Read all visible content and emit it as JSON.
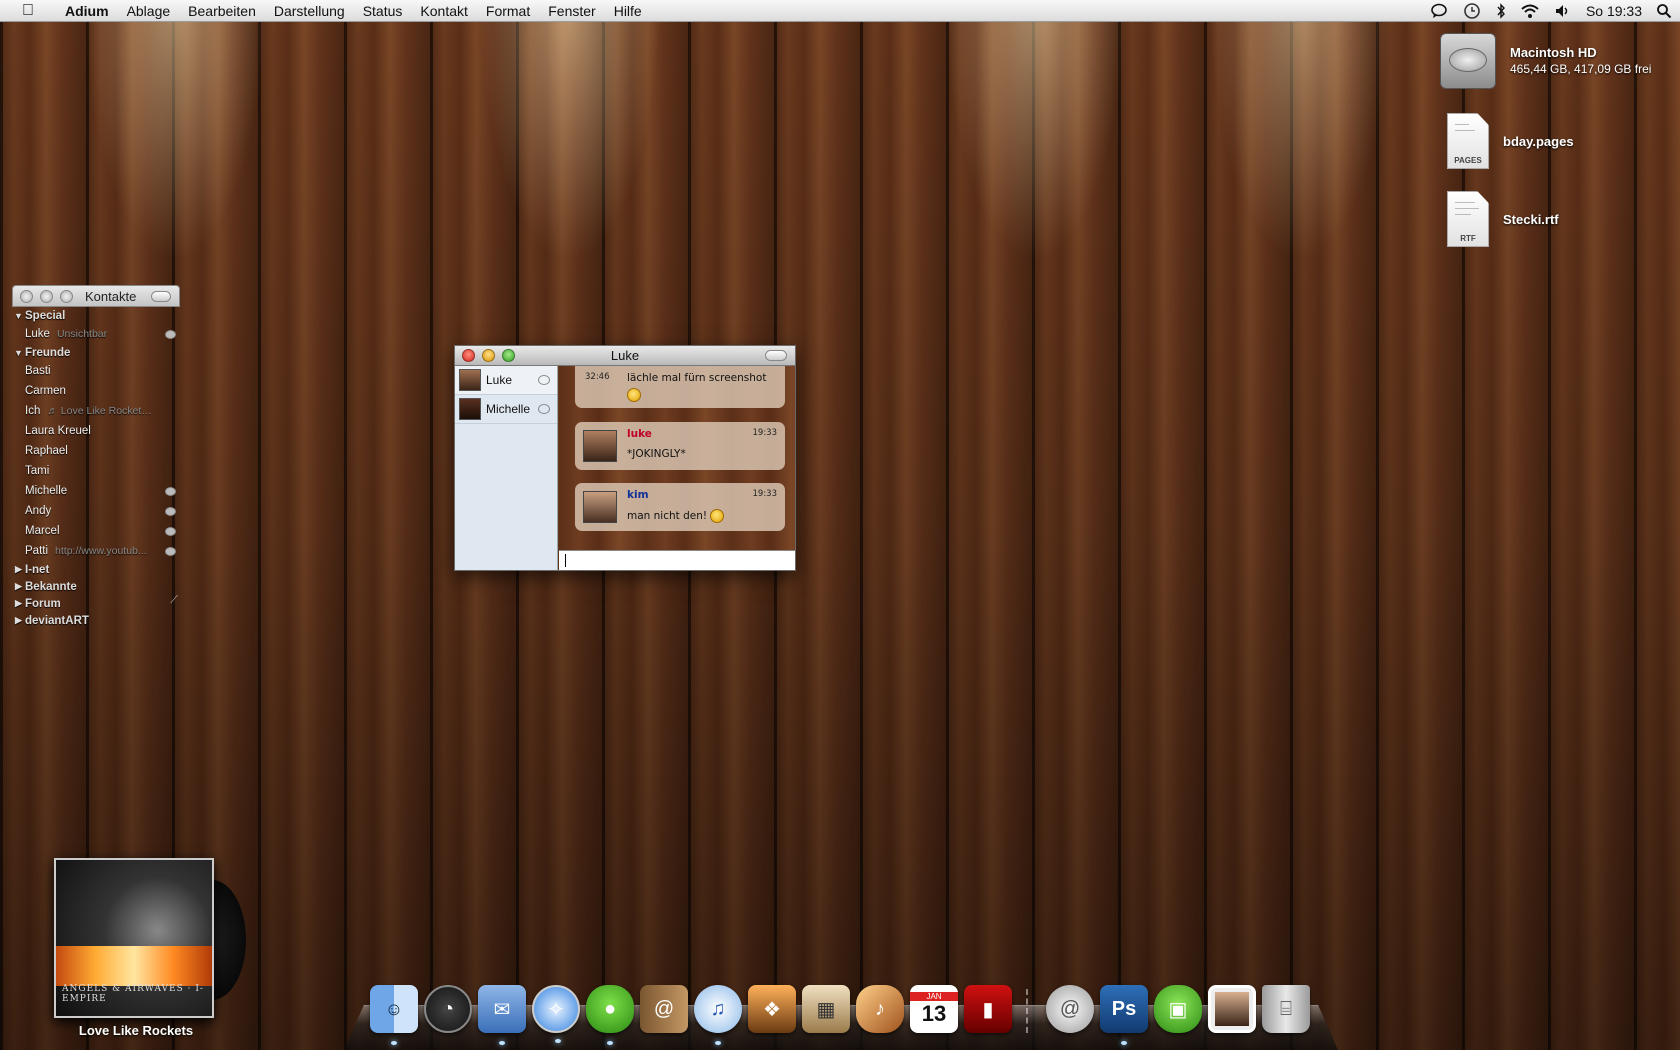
{
  "menubar": {
    "items": [
      "Adium",
      "Ablage",
      "Bearbeiten",
      "Darstellung",
      "Status",
      "Kontakt",
      "Format",
      "Fenster",
      "Hilfe"
    ],
    "clock": "So 19:33"
  },
  "desktop": {
    "hd": {
      "name": "Macintosh HD",
      "info": "465,44 GB, 417,09 GB frei"
    },
    "files": [
      {
        "name": "bday.pages",
        "tag": "PAGES"
      },
      {
        "name": "Stecki.rtf",
        "tag": "RTF"
      }
    ]
  },
  "contacts": {
    "title": "Kontakte",
    "groups": {
      "special": "Special",
      "freunde": "Freunde",
      "inet": "I-net",
      "bekannte": "Bekannte",
      "forum": "Forum",
      "deviantart": "deviantART"
    },
    "special": [
      {
        "name": "Luke",
        "status": "Unsichtbar"
      }
    ],
    "freunde": [
      {
        "name": "Basti",
        "status": ""
      },
      {
        "name": "Carmen",
        "status": ""
      },
      {
        "name": "Ich",
        "status": "♬ Love Like Rockets ..."
      },
      {
        "name": "Laura Kreuel",
        "status": ""
      },
      {
        "name": "Raphael",
        "status": ""
      },
      {
        "name": "Tami",
        "status": ""
      },
      {
        "name": "Michelle",
        "status": ""
      },
      {
        "name": "Andy",
        "status": ""
      },
      {
        "name": "Marcel",
        "status": ""
      },
      {
        "name": "Patti",
        "status": "http://www.youtub..."
      }
    ]
  },
  "chat": {
    "title": "Luke",
    "tabs": [
      "Luke",
      "Michelle"
    ],
    "messages": [
      {
        "time": "32:46",
        "sender": "",
        "text": "lächle mal fürn screenshot"
      },
      {
        "time": "19:33",
        "sender": "luke",
        "text": "*JOKINGLY*"
      },
      {
        "time": "19:33",
        "sender": "kim",
        "text": "man nicht den!"
      }
    ],
    "input_value": ""
  },
  "album": {
    "label": "Love Like Rockets",
    "cover_text": "ANGELS & AIRWAVES · I-EMPIRE"
  },
  "dock": {
    "apps": [
      "Finder",
      "Dashboard",
      "Mail",
      "Safari",
      "Adium",
      "Address Book",
      "iTunes",
      "iPhoto",
      "Preview",
      "GarageBand",
      "iCal",
      "Front Row",
      "Mail Downloads",
      "Photoshop",
      "Adium Docs",
      "Photo",
      "Trash"
    ],
    "ical_month": "JAN",
    "ical_day": "13",
    "photoshop": "Ps"
  }
}
